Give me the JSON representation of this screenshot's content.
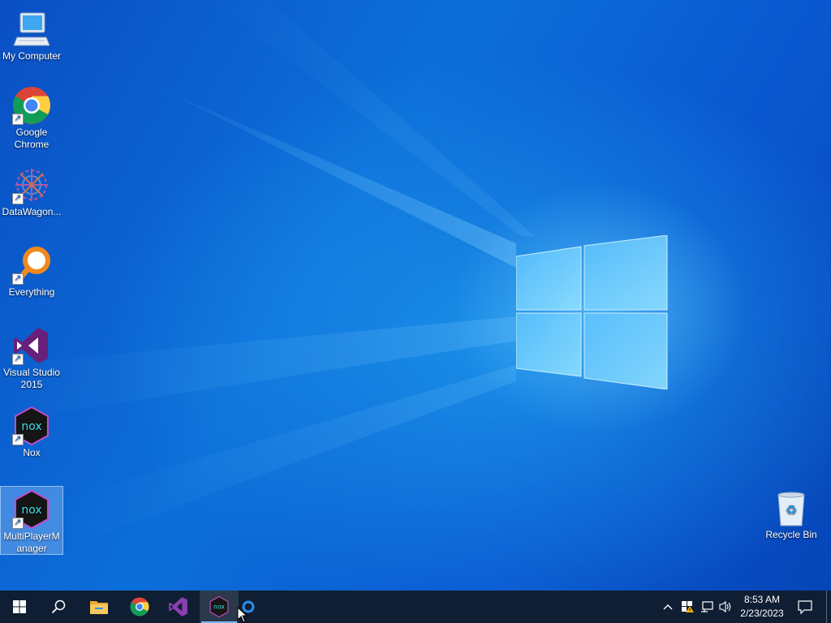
{
  "desktop": {
    "icons": [
      {
        "label": "My Computer",
        "icon": "monitor-icon"
      },
      {
        "label": "Google Chrome",
        "icon": "chrome-icon"
      },
      {
        "label": "DataWagon...",
        "icon": "datawagon-icon"
      },
      {
        "label": "Everything",
        "icon": "search-magnifier-icon"
      },
      {
        "label": "Visual Studio 2015",
        "icon": "visual-studio-icon"
      },
      {
        "label": "Nox",
        "icon": "nox-icon"
      },
      {
        "label": "MultiPlayerManager",
        "icon": "nox-multiplayer-icon"
      },
      {
        "label": "Recycle Bin",
        "icon": "recycle-bin-icon"
      }
    ]
  },
  "taskbar": {
    "buttons": [
      {
        "name": "start",
        "icon": "windows-logo-icon"
      },
      {
        "name": "search",
        "icon": "search-icon"
      },
      {
        "name": "file-explorer",
        "icon": "folder-icon"
      },
      {
        "name": "chrome",
        "icon": "chrome-icon"
      },
      {
        "name": "visual-studio",
        "icon": "visual-studio-icon"
      },
      {
        "name": "nox",
        "icon": "nox-icon"
      },
      {
        "name": "circle-app",
        "icon": "circle-icon"
      }
    ],
    "tray": {
      "time": "8:53 AM",
      "date": "2/23/2023"
    }
  },
  "colors": {
    "taskbar": "#0f1e33",
    "desktop_blue": "#0c6fd9",
    "visual_studio": "#68217a",
    "everything_orange": "#f08a1c"
  }
}
